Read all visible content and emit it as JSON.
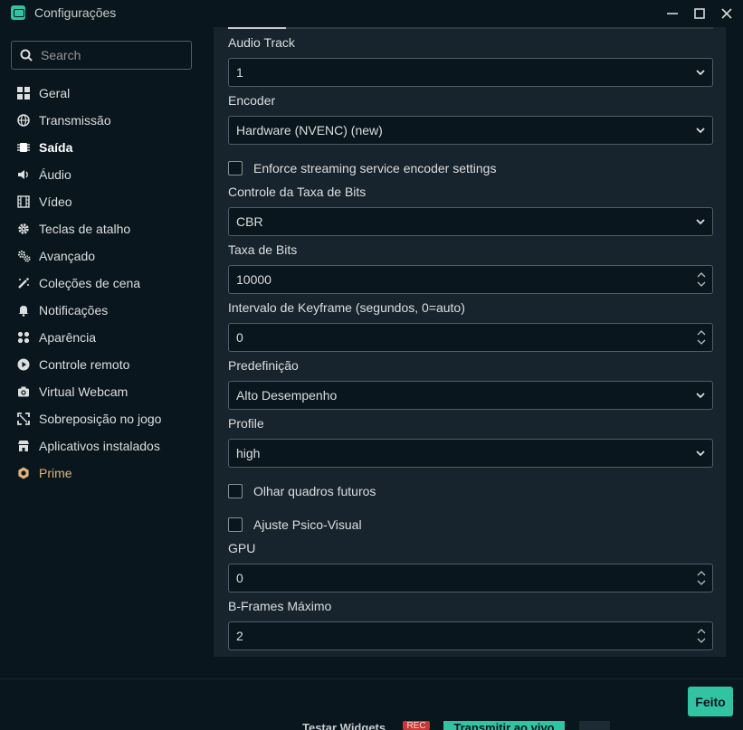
{
  "window": {
    "title": "Configurações"
  },
  "search": {
    "placeholder": "Search"
  },
  "nav": [
    {
      "label": "Geral",
      "icon": "grid-icon"
    },
    {
      "label": "Transmissão",
      "icon": "globe-icon"
    },
    {
      "label": "Saída",
      "icon": "chip-icon",
      "active": true
    },
    {
      "label": "Áudio",
      "icon": "speaker-icon"
    },
    {
      "label": "Vídeo",
      "icon": "film-icon"
    },
    {
      "label": "Teclas de atalho",
      "icon": "gear-icon"
    },
    {
      "label": "Avançado",
      "icon": "gears-icon"
    },
    {
      "label": "Coleções de cena",
      "icon": "wand-icon"
    },
    {
      "label": "Notificações",
      "icon": "bell-icon"
    },
    {
      "label": "Aparência",
      "icon": "palette-icon"
    },
    {
      "label": "Controle remoto",
      "icon": "play-circle-icon"
    },
    {
      "label": "Virtual Webcam",
      "icon": "camera-icon"
    },
    {
      "label": "Sobreposição no jogo",
      "icon": "expand-icon"
    },
    {
      "label": "Aplicativos instalados",
      "icon": "store-icon"
    },
    {
      "label": "Prime",
      "icon": "prime-icon"
    }
  ],
  "form": {
    "audio_track": {
      "label": "Audio Track",
      "value": "1"
    },
    "encoder": {
      "label": "Encoder",
      "value": "Hardware (NVENC) (new)"
    },
    "enforce": {
      "label": "Enforce streaming service encoder settings",
      "checked": false
    },
    "rate_control": {
      "label": "Controle da Taxa de Bits",
      "value": "CBR"
    },
    "bitrate": {
      "label": "Taxa de Bits",
      "value": "10000"
    },
    "keyframe": {
      "label": "Intervalo de Keyframe (segundos, 0=auto)",
      "value": "0"
    },
    "preset": {
      "label": "Predefinição",
      "value": "Alto Desempenho"
    },
    "profile": {
      "label": "Profile",
      "value": "high"
    },
    "lookahead": {
      "label": "Olhar quadros futuros",
      "checked": false
    },
    "psycho": {
      "label": "Ajuste Psico-Visual",
      "checked": false
    },
    "gpu": {
      "label": "GPU",
      "value": "0"
    },
    "bframes": {
      "label": "B-Frames Máximo",
      "value": "2"
    }
  },
  "footer": {
    "done_label": "Feito",
    "underlay": {
      "test_widgets": "Testar Widgets",
      "rec": "REC",
      "go_live": "Transmitir ao vivo"
    }
  },
  "colors": {
    "accent": "#31c3a2",
    "prime": "#e2b37a",
    "panel": "#17242d",
    "background": "#09161d"
  }
}
